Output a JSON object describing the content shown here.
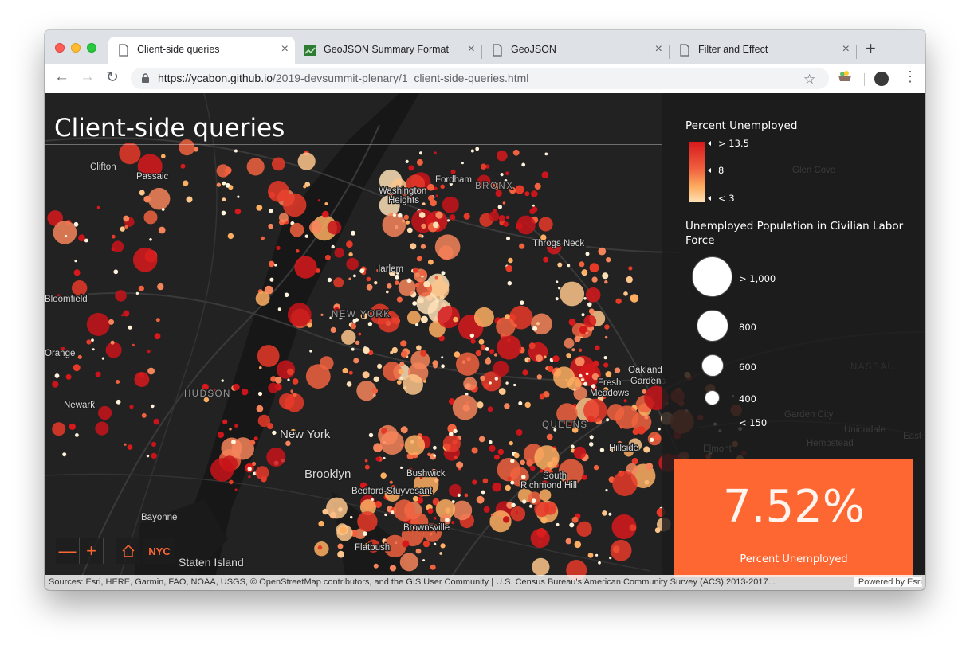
{
  "browser": {
    "tabs": [
      {
        "title": "Client-side queries",
        "icon": "page-icon",
        "active": true
      },
      {
        "title": "GeoJSON Summary Format",
        "icon": "geojson-icon",
        "active": false
      },
      {
        "title": "GeoJSON",
        "icon": "page-icon",
        "active": false
      },
      {
        "title": "Filter and Effect",
        "icon": "page-icon",
        "active": false
      }
    ],
    "url_host": "https://ycabon.github.io",
    "url_path": "/2019-devsummit-plenary/1_client-side-queries.html"
  },
  "map": {
    "title": "Client-side queries",
    "labels": [
      "Clifton",
      "Passaic",
      "Fordham",
      "BRONX",
      "Washington",
      "Heights",
      "Glen Cove",
      "Throgs Neck",
      "Harlem",
      "NEW YORK",
      "Bloomfield",
      "Orange",
      "Oakland",
      "Gardens",
      "NASSAU",
      "HUDSON",
      "Fresh",
      "Meadows",
      "Newark",
      "Garden City",
      "Uniondale",
      "New York",
      "QUEENS",
      "Hillside",
      "Hempstead",
      "Elmont",
      "Brooklyn",
      "Bushwick",
      "Bedford-Stuyvesant",
      "South",
      "Richmond Hill",
      "Bayonne",
      "Brownsville",
      "Flatbush",
      "Staten Island",
      "East"
    ]
  },
  "legend": {
    "color_title": "Percent Unemployed",
    "color_stops": [
      {
        "label": "> 13.5",
        "color": "#d7191c"
      },
      {
        "label": "8",
        "color": "#f0613e"
      },
      {
        "label": "< 3",
        "color": "#fee0b6"
      }
    ],
    "size_title": "Unemployed Population in Civilian Labor Force",
    "size_stops": [
      "> 1,000",
      "800",
      "600",
      "400",
      "< 150"
    ]
  },
  "stat": {
    "value": "7.52%",
    "label": "Percent Unemployed"
  },
  "controls": {
    "zoom_out": "—",
    "zoom_in": "+",
    "bookmark": "NYC"
  },
  "attribution": {
    "sources": "Sources: Esri, HERE, Garmin, FAO, NOAA, USGS, © OpenStreetMap contributors, and the GIS User Community | U.S. Census Bureau's American Community Survey (ACS) 2013-2017...",
    "powered": "Powered by Esri"
  },
  "colors": {
    "accent": "#fe6732",
    "high": "#d7191c",
    "mid": "#f0613e",
    "low": "#fee0b6"
  }
}
